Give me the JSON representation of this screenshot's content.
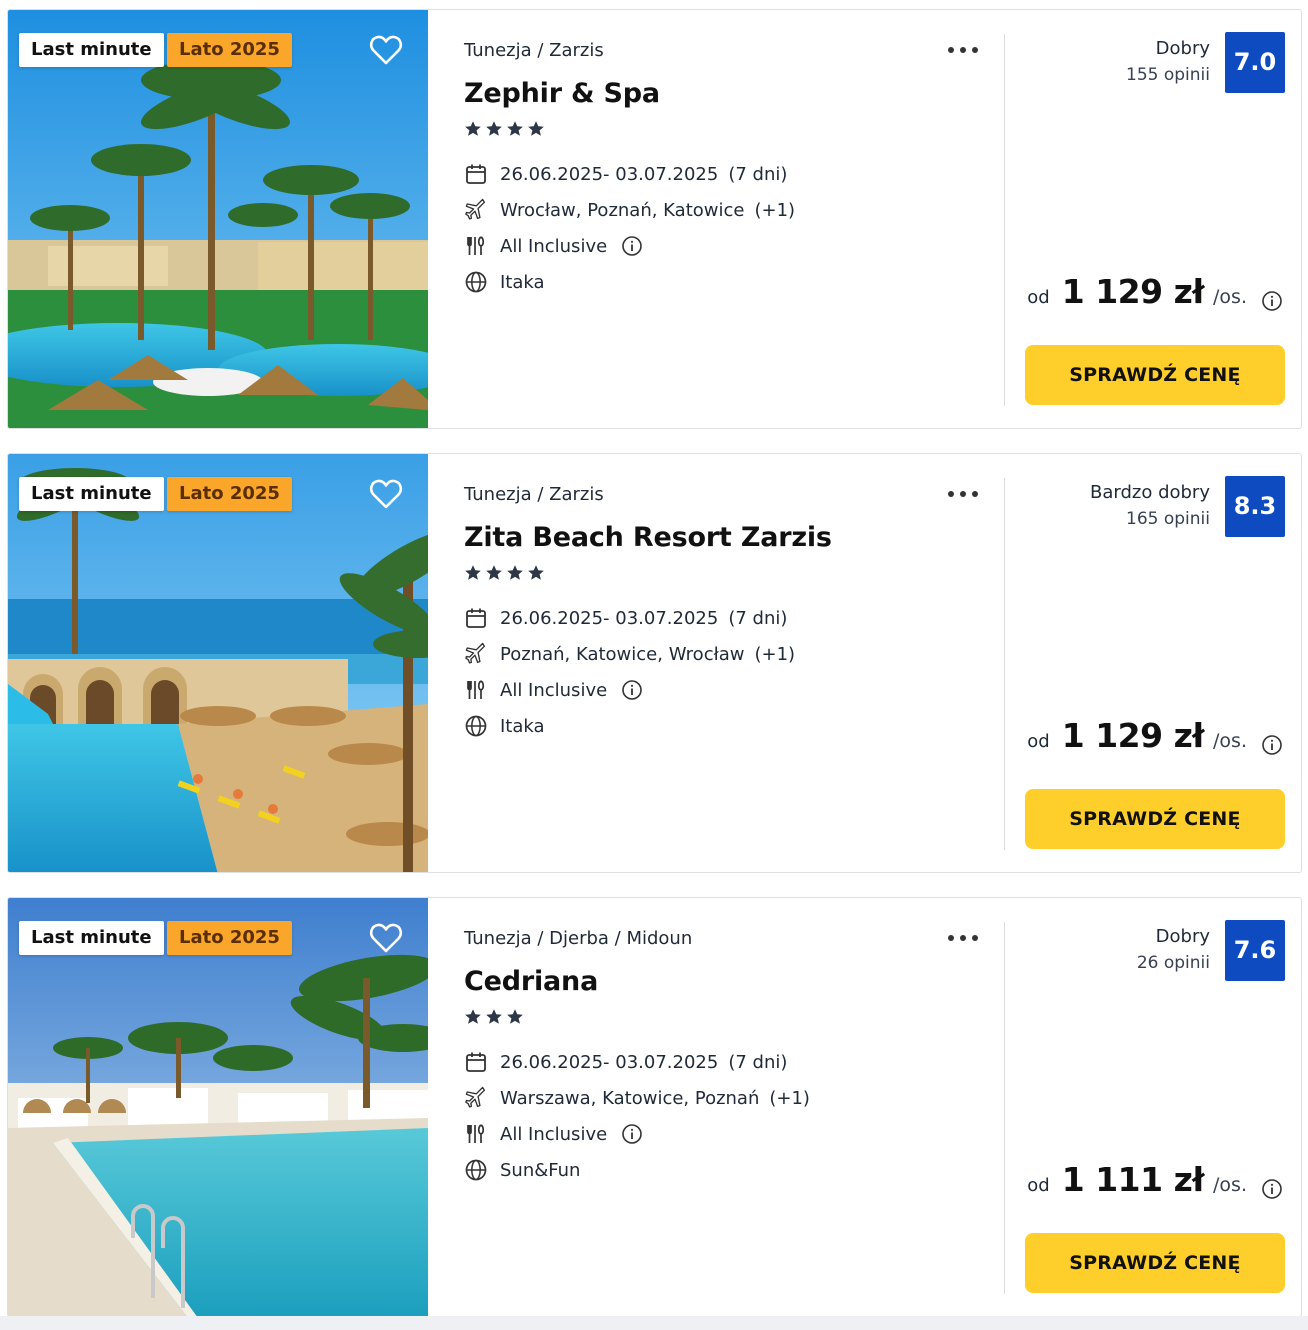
{
  "colors": {
    "accent_blue": "#0e4bc1",
    "cta_yellow": "#fecf2a",
    "badge_orange": "#f9a62b",
    "text_dark": "#111111"
  },
  "offers": [
    {
      "badges": [
        "Last minute",
        "Lato 2025"
      ],
      "location": "Tunezja / Zarzis",
      "name": "Zephir & Spa",
      "stars": 4,
      "dates": "26.06.2025- 03.07.2025",
      "duration": "(7 dni)",
      "departures": "Wrocław, Poznań, Katowice",
      "departures_extra": "(+1)",
      "board": "All Inclusive",
      "operator": "Itaka",
      "rating_label": "Dobry",
      "reviews": "155 opinii",
      "score": "7.0",
      "price_prefix": "od",
      "price": "1 129 zł",
      "price_suffix": "/os.",
      "cta": "SPRAWDŹ CENĘ",
      "photo_icon": "resort-photo-palms-pool"
    },
    {
      "badges": [
        "Last minute",
        "Lato 2025"
      ],
      "location": "Tunezja / Zarzis",
      "name": "Zita Beach Resort Zarzis",
      "stars": 4,
      "dates": "26.06.2025- 03.07.2025",
      "duration": "(7 dni)",
      "departures": "Poznań, Katowice, Wrocław",
      "departures_extra": "(+1)",
      "board": "All Inclusive",
      "operator": "Itaka",
      "rating_label": "Bardzo dobry",
      "reviews": "165 opinii",
      "score": "8.3",
      "price_prefix": "od",
      "price": "1 129 zł",
      "price_suffix": "/os.",
      "cta": "SPRAWDŹ CENĘ",
      "photo_icon": "resort-photo-sea-pool"
    },
    {
      "badges": [
        "Last minute",
        "Lato 2025"
      ],
      "location": "Tunezja / Djerba / Midoun",
      "name": "Cedriana",
      "stars": 3,
      "dates": "26.06.2025- 03.07.2025",
      "duration": "(7 dni)",
      "departures": "Warszawa, Katowice, Poznań",
      "departures_extra": "(+1)",
      "board": "All Inclusive",
      "operator": "Sun&Fun",
      "rating_label": "Dobry",
      "reviews": "26 opinii",
      "score": "7.6",
      "price_prefix": "od",
      "price": "1 111 zł",
      "price_suffix": "/os.",
      "cta": "SPRAWDŹ CENĘ",
      "photo_icon": "resort-photo-pool-bungalows"
    }
  ]
}
